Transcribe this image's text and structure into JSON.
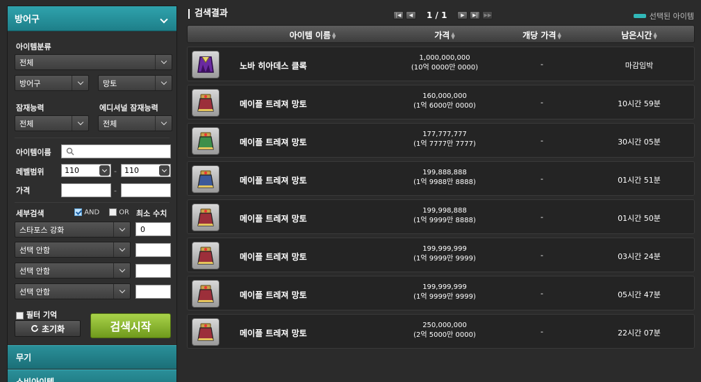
{
  "left": {
    "category_title": "방어구",
    "item_category_label": "아이템분류",
    "item_category_value": "전체",
    "sub_category_1": "방어구",
    "sub_category_2": "망토",
    "potential_label": "잠재능력",
    "potential_value": "전체",
    "additional_potential_label": "에디셔널 잠재능력",
    "additional_potential_value": "전체",
    "item_name_label": "아이템이름",
    "item_name_value": "",
    "level_range_label": "레벨범위",
    "level_min": "110",
    "level_max": "110",
    "price_label": "가격",
    "price_min": "",
    "price_max": "",
    "detail_search_label": "세부검색",
    "and_label": "AND",
    "or_label": "OR",
    "min_value_label": "최소 수치",
    "detail_rows": [
      {
        "option": "스타포스 강화",
        "value": "0"
      },
      {
        "option": "선택 안함",
        "value": ""
      },
      {
        "option": "선택 안함",
        "value": ""
      },
      {
        "option": "선택 안함",
        "value": ""
      }
    ],
    "filter_memory_label": "필터 기억",
    "reset_label": "초기화",
    "search_label": "검색시작",
    "collapsed_categories": [
      "무기",
      "소비아이템"
    ]
  },
  "right": {
    "title": "검색결과",
    "page": "1 / 1",
    "selected_legend": "선택된 아이템",
    "headers": {
      "name": "아이템 이름",
      "price": "가격",
      "unit_price": "개당 가격",
      "time_left": "남은시간"
    },
    "rows": [
      {
        "name": "노바 히아데스 클록",
        "price": "1,000,000,000",
        "price_kor": "(10억 0000만 0000)",
        "unit": "-",
        "time": "마감임박",
        "icon": "purple-cloak-icon"
      },
      {
        "name": "메이플 트레져 망토",
        "price": "160,000,000",
        "price_kor": "(1억 6000만 0000)",
        "unit": "-",
        "time": "10시간 59분",
        "icon": "red-cape-icon"
      },
      {
        "name": "메이플 트레져 망토",
        "price": "177,777,777",
        "price_kor": "(1억 7777만 7777)",
        "unit": "-",
        "time": "30시간 05분",
        "icon": "green-cape-icon"
      },
      {
        "name": "메이플 트레져 망토",
        "price": "199,888,888",
        "price_kor": "(1억 9988만 8888)",
        "unit": "-",
        "time": "01시간 51분",
        "icon": "blue-cape-icon"
      },
      {
        "name": "메이플 트레져 망토",
        "price": "199,998,888",
        "price_kor": "(1억 9999만 8888)",
        "unit": "-",
        "time": "01시간 50분",
        "icon": "red-cape-icon"
      },
      {
        "name": "메이플 트레져 망토",
        "price": "199,999,999",
        "price_kor": "(1억 9999만 9999)",
        "unit": "-",
        "time": "03시간 24분",
        "icon": "red-cape-icon"
      },
      {
        "name": "메이플 트레져 망토",
        "price": "199,999,999",
        "price_kor": "(1억 9999만 9999)",
        "unit": "-",
        "time": "05시간 47분",
        "icon": "red-cape-icon"
      },
      {
        "name": "메이플 트레져 망토",
        "price": "250,000,000",
        "price_kor": "(2억 5000만 0000)",
        "unit": "-",
        "time": "22시간 07분",
        "icon": "red-cape-icon"
      }
    ]
  },
  "colors": {
    "accent_teal": "#1e7f89",
    "search_green": "#8cbf2f",
    "cape_red": "#9c2f3a",
    "cape_green": "#3e8f4a",
    "cape_blue": "#3d5a9a",
    "cloak_purple": "#6a2aa0"
  }
}
